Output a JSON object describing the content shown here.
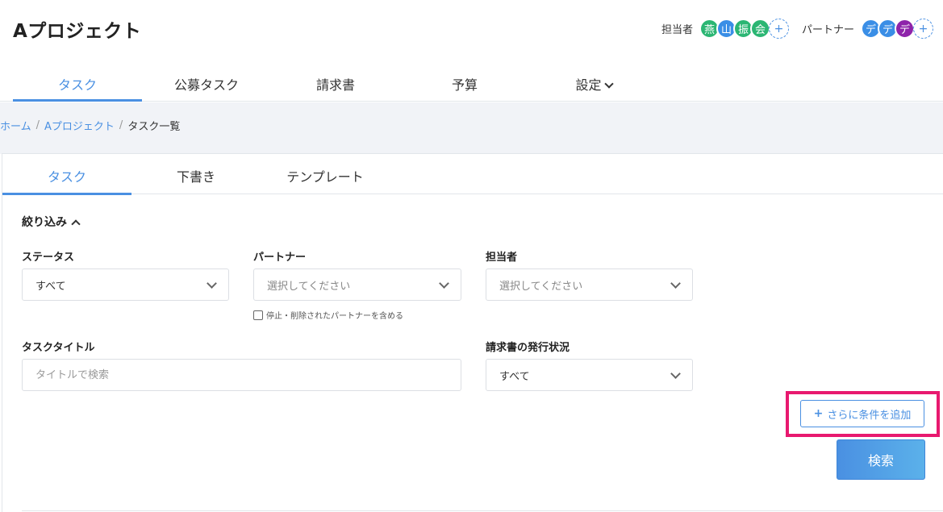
{
  "header": {
    "title": "Aプロジェクト",
    "assignee_label": "担当者",
    "assignees": [
      {
        "initial": "燕",
        "color": "#2bb673"
      },
      {
        "initial": "山",
        "color": "#3a8ee6"
      },
      {
        "initial": "振",
        "color": "#2bb673"
      },
      {
        "initial": "会",
        "color": "#2bb673"
      }
    ],
    "partner_label": "パートナー",
    "partners": [
      {
        "initial": "デ",
        "color": "#3a8ee6"
      },
      {
        "initial": "デ",
        "color": "#3a8ee6"
      },
      {
        "initial": "デ",
        "color": "#8e24aa"
      }
    ],
    "add_symbol": "+"
  },
  "main_tabs": [
    {
      "label": "タスク",
      "active": true
    },
    {
      "label": "公募タスク",
      "active": false
    },
    {
      "label": "請求書",
      "active": false
    },
    {
      "label": "予算",
      "active": false
    },
    {
      "label": "設定",
      "active": false
    }
  ],
  "breadcrumb": {
    "home": "ホーム",
    "project": "Aプロジェクト",
    "current": "タスク一覧",
    "separator": "/"
  },
  "sub_tabs": [
    {
      "label": "タスク",
      "active": true
    },
    {
      "label": "下書き",
      "active": false
    },
    {
      "label": "テンプレート",
      "active": false
    }
  ],
  "filter": {
    "title": "絞り込み",
    "status": {
      "label": "ステータス",
      "value": "すべて"
    },
    "partner": {
      "label": "パートナー",
      "placeholder": "選択してください"
    },
    "assignee": {
      "label": "担当者",
      "placeholder": "選択してください"
    },
    "include_stopped_label": "停止・削除されたパートナーを含める",
    "task_title": {
      "label": "タスクタイトル",
      "placeholder": "タイトルで検索"
    },
    "invoice_status": {
      "label": "請求書の発行状況",
      "value": "すべて"
    },
    "add_condition_label": "さらに条件を追加",
    "add_condition_icon": "+",
    "search_label": "検索"
  },
  "colors": {
    "accent": "#4a90e2",
    "highlight": "#e8196f"
  }
}
